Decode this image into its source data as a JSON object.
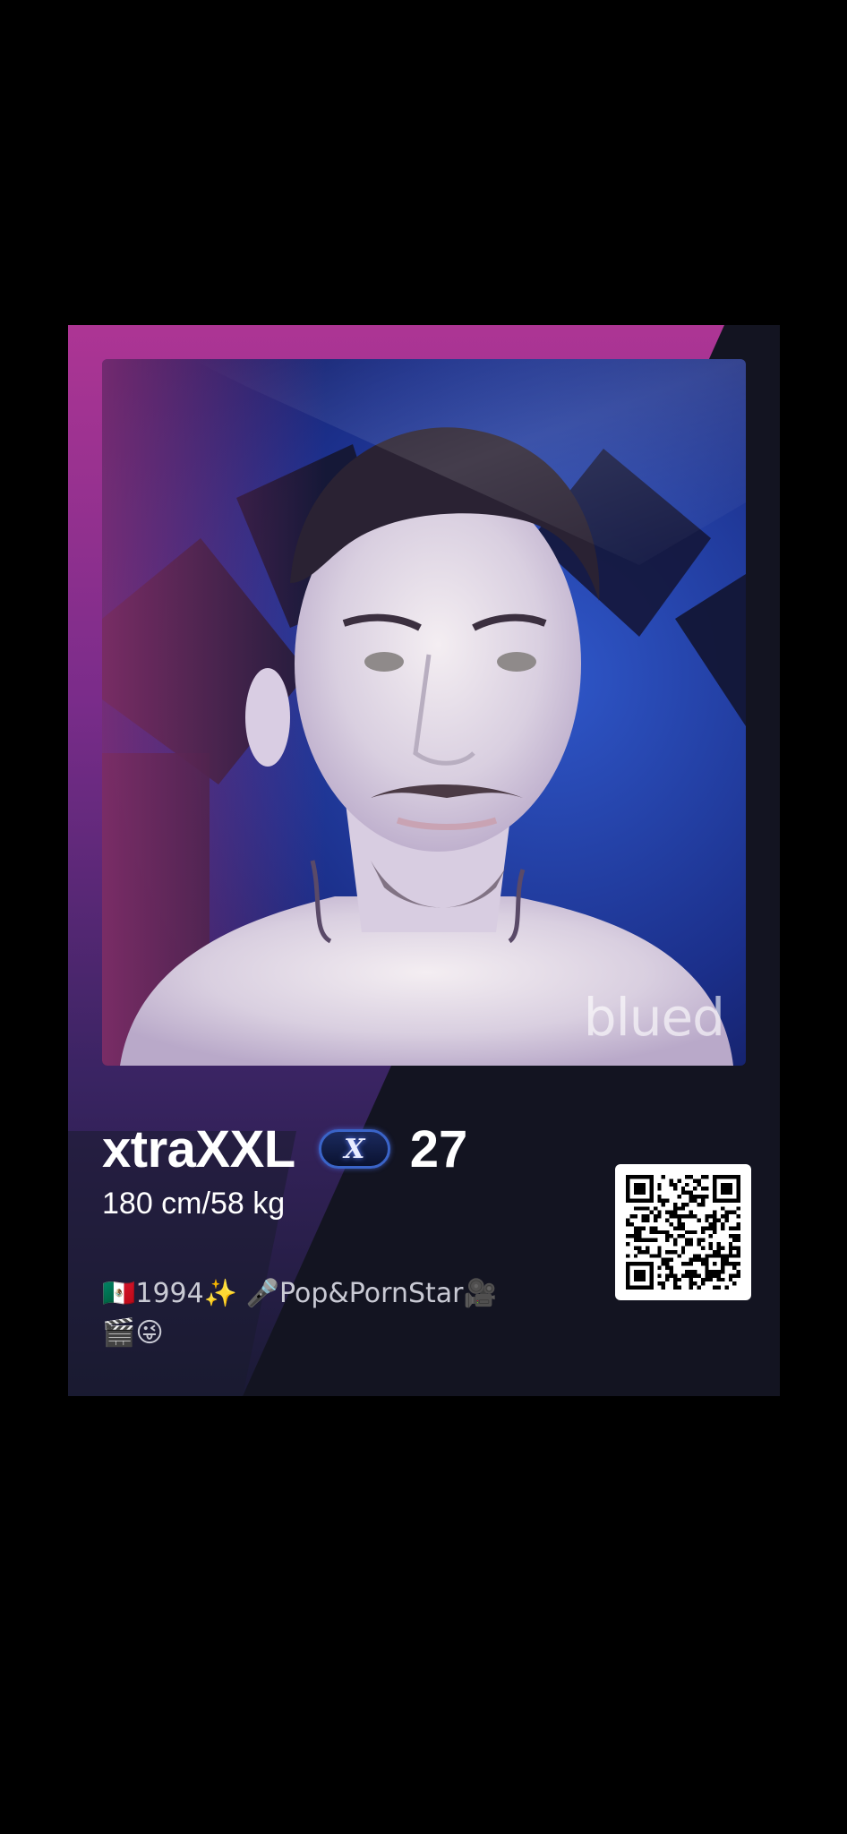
{
  "profile": {
    "username": "xtraXXL",
    "vip_badge": "X",
    "age": "27",
    "stats": "180 cm/58 kg",
    "bio": "🇲🇽1994✨ 🎤Pop&PornStar🎥🎬😜",
    "watermark": "blued"
  },
  "colors": {
    "card_background": "#131421",
    "accent_magenta": "#a8338f",
    "badge_blue": "#3a64c8"
  },
  "icons": {
    "vip": "x-vip-badge-icon",
    "qr": "qr-code-icon"
  }
}
